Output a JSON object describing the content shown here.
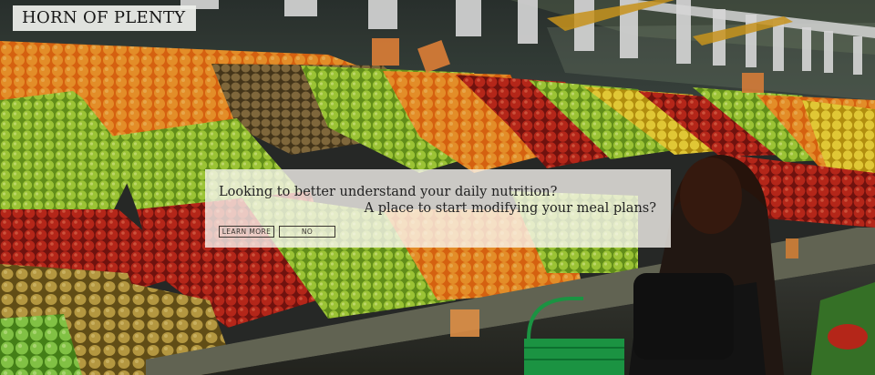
{
  "brand": {
    "name": "HORN OF PLENTY"
  },
  "prompt": {
    "line1": "Looking to better understand your daily nutrition?",
    "line2": "A place to start modifying your meal plans?"
  },
  "actions": {
    "learn_more": "LEARN MORE",
    "no": "NO"
  },
  "colors": {
    "card_background": "#faf7f2",
    "accent_text": "#222222",
    "logo_background": "#eef0ec"
  }
}
